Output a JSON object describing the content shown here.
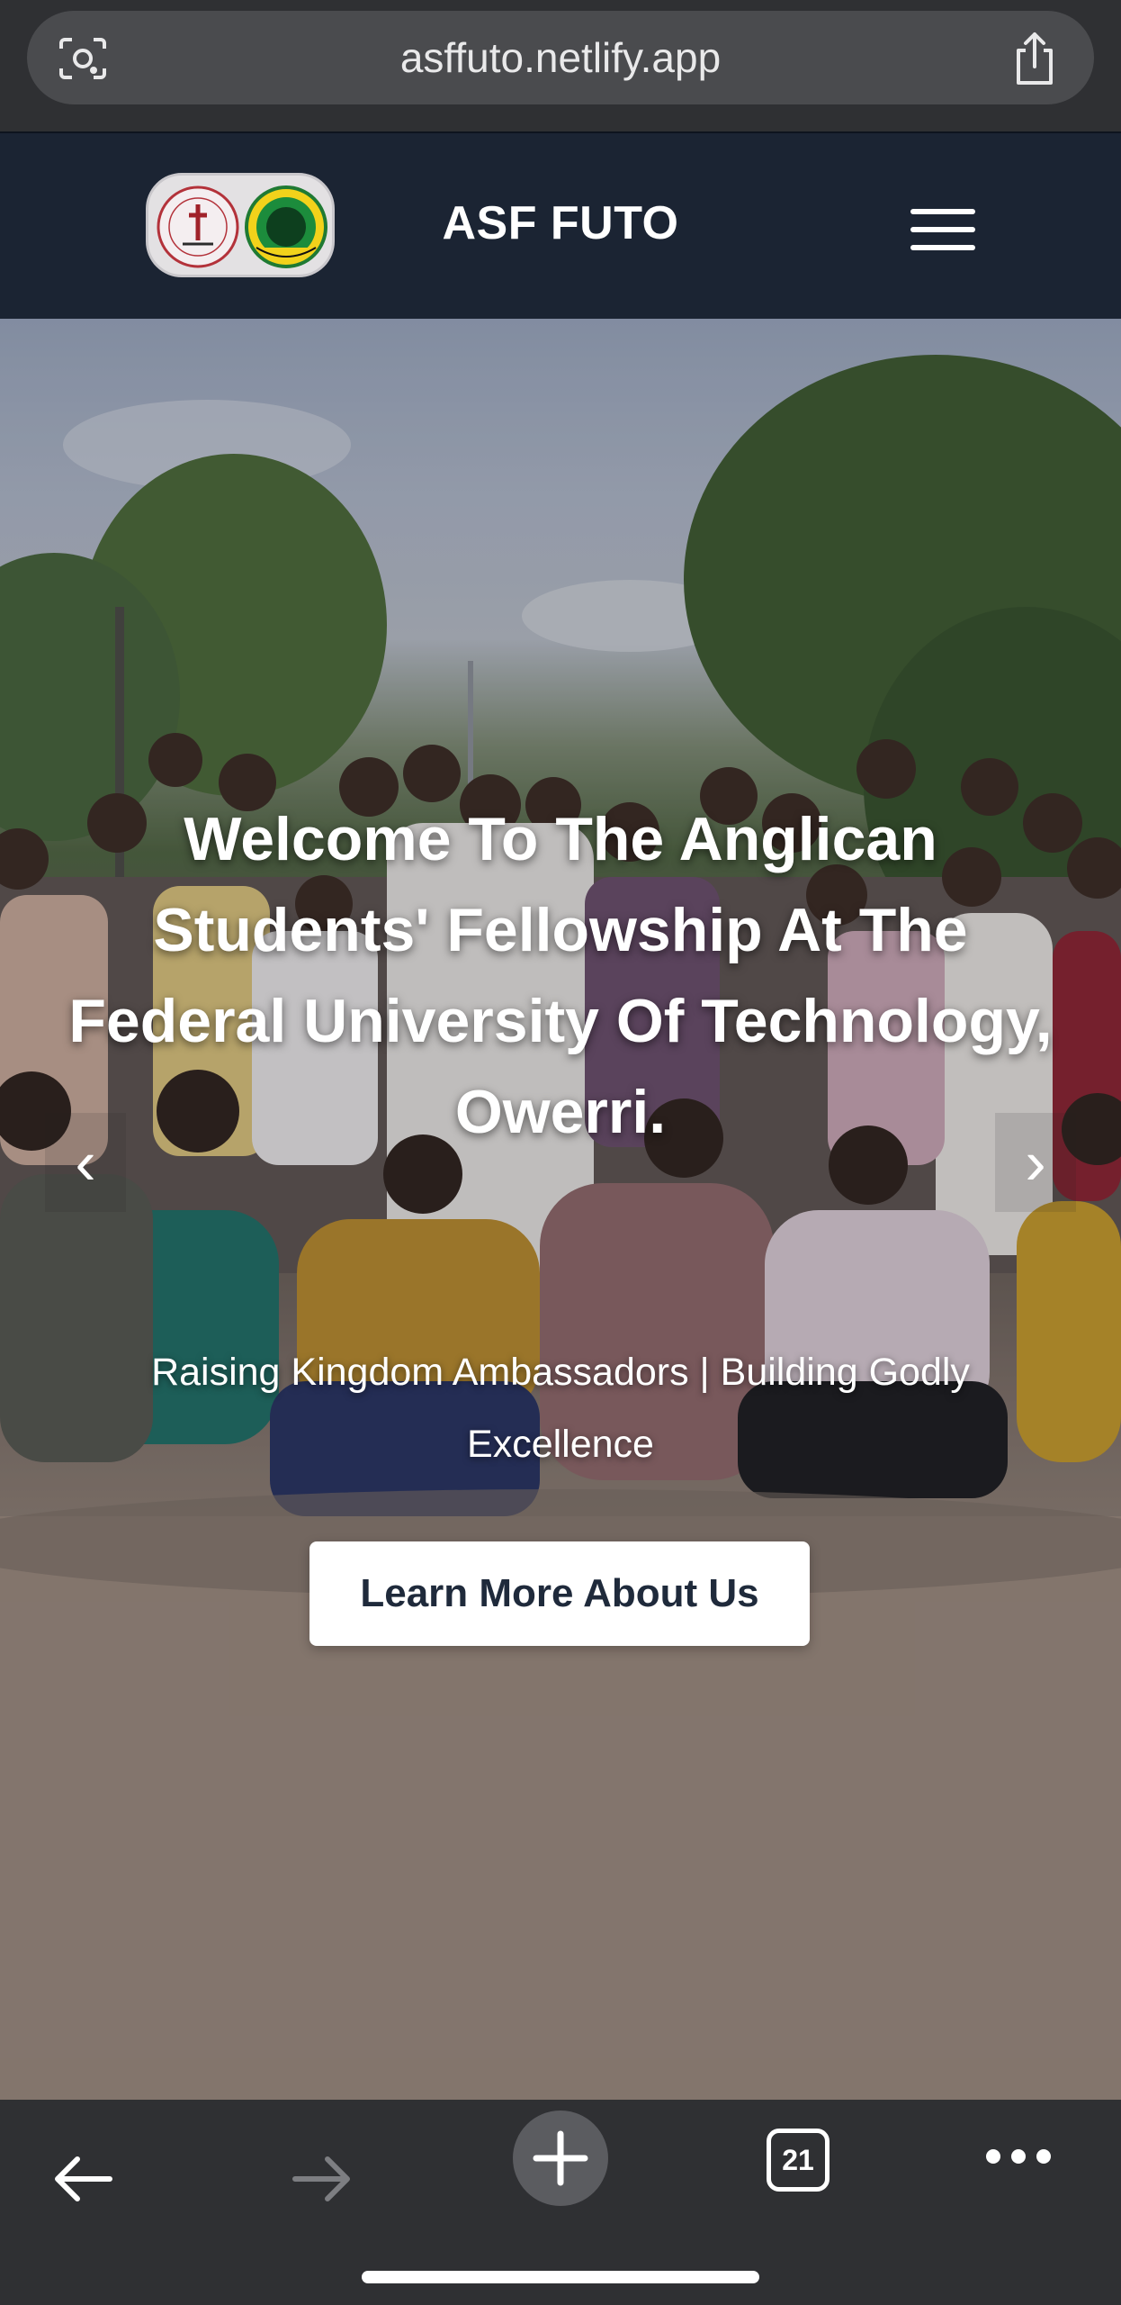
{
  "browser": {
    "url": "asffuto.netlify.app",
    "tab_count": "21",
    "icons": {
      "lens": "visual-search-icon",
      "share": "share-icon",
      "back": "back-arrow-icon",
      "forward": "forward-arrow-icon",
      "new_tab": "plus-icon",
      "tabs": "tab-switcher-icon",
      "more": "more-dots-icon"
    }
  },
  "header": {
    "title": "ASF FUTO",
    "background": "#1b2433",
    "logos": [
      "anglican-students-fellowship-seal",
      "futo-seal"
    ],
    "menu_icon": "hamburger-menu-icon"
  },
  "hero": {
    "title": "Welcome To The Anglican Students' Fellowship At The Federal University Of Technology, Owerri.",
    "subtitle": "Raising Kingdom Ambassadors | Building Godly Excellence",
    "cta_label": "Learn More About Us",
    "prev_arrow": "‹",
    "next_arrow": "›",
    "background_image": "group-photo-of-students-outdoors"
  }
}
